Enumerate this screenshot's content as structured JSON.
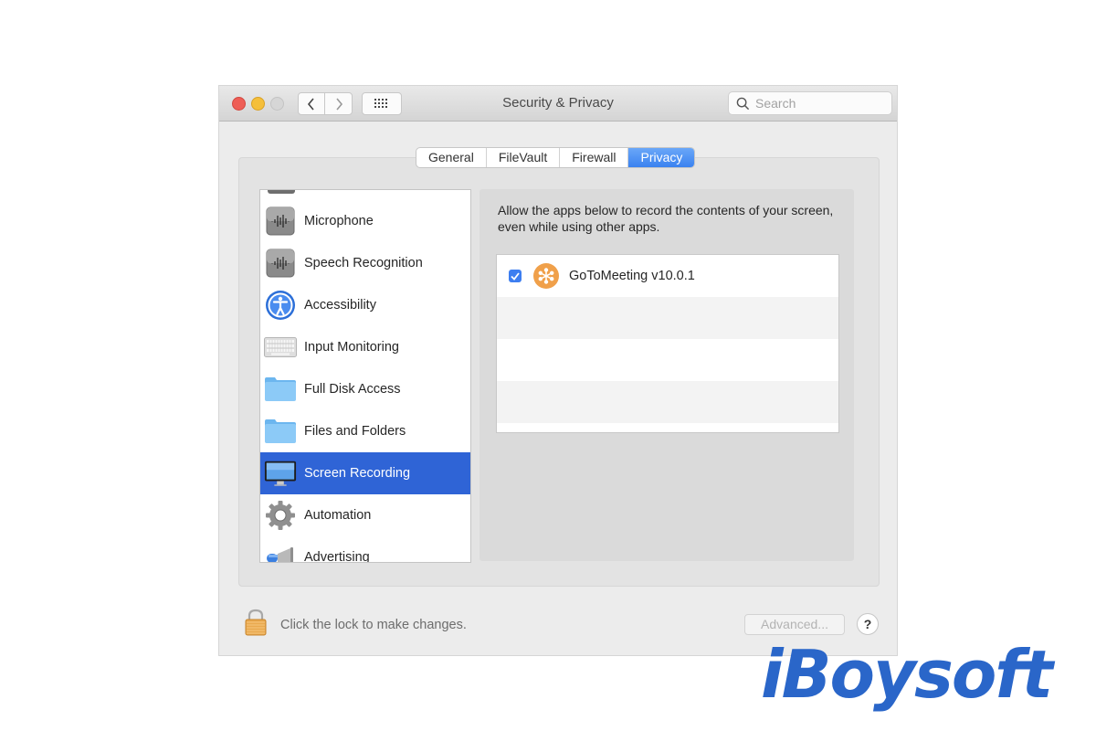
{
  "window": {
    "title": "Security & Privacy",
    "search_placeholder": "Search"
  },
  "toolbar": {
    "back_icon": "chevron-left-icon",
    "forward_icon": "chevron-right-icon",
    "grid_icon": "grid-icon"
  },
  "tabs": [
    {
      "label": "General",
      "active": false
    },
    {
      "label": "FileVault",
      "active": false
    },
    {
      "label": "Firewall",
      "active": false
    },
    {
      "label": "Privacy",
      "active": true
    }
  ],
  "sidebar": {
    "items": [
      {
        "label": "Microphone",
        "icon": "waveform-icon",
        "selected": false
      },
      {
        "label": "Speech Recognition",
        "icon": "waveform-icon",
        "selected": false
      },
      {
        "label": "Accessibility",
        "icon": "accessibility-icon",
        "selected": false
      },
      {
        "label": "Input Monitoring",
        "icon": "keyboard-icon",
        "selected": false
      },
      {
        "label": "Full Disk Access",
        "icon": "folder-icon",
        "selected": false
      },
      {
        "label": "Files and Folders",
        "icon": "folder-icon",
        "selected": false
      },
      {
        "label": "Screen Recording",
        "icon": "monitor-icon",
        "selected": true
      },
      {
        "label": "Automation",
        "icon": "gear-icon",
        "selected": false
      },
      {
        "label": "Advertising",
        "icon": "megaphone-icon",
        "selected": false
      }
    ]
  },
  "main": {
    "description": "Allow the apps below to record the contents of your screen, even while using other apps.",
    "apps": [
      {
        "name": "GoToMeeting v10.0.1",
        "checked": true,
        "icon": "gotomeeting-icon"
      }
    ]
  },
  "footer": {
    "lock_text": "Click the lock to make changes.",
    "advanced_label": "Advanced...",
    "help_label": "?"
  },
  "watermark": {
    "text": "iBoysoft"
  },
  "colors": {
    "accent": "#2f64d6",
    "checkbox": "#3d7ef0",
    "app_icon": "#f0a04a",
    "logo": "#2a66c9"
  }
}
